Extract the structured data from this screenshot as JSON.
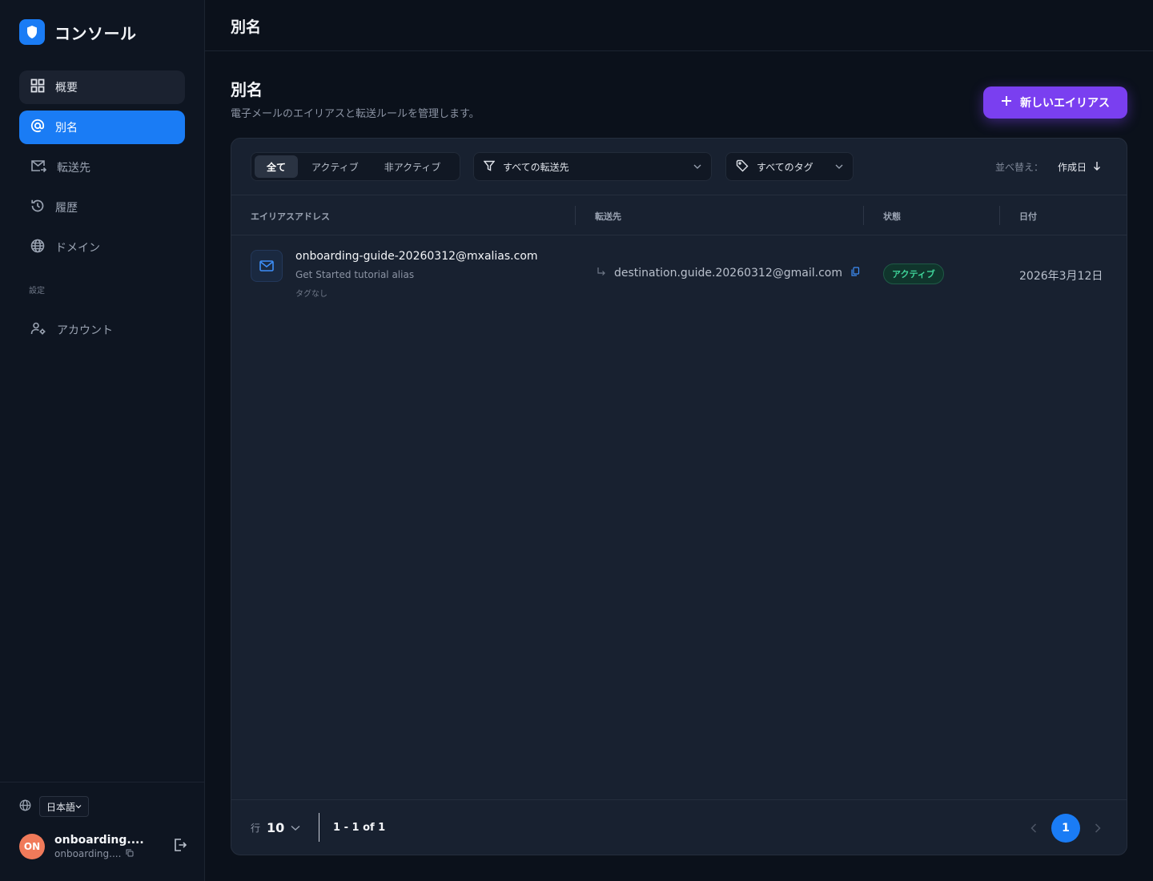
{
  "app": {
    "name": "コンソール"
  },
  "sidebar": {
    "items": [
      {
        "label": "概要",
        "icon": "grid-icon"
      },
      {
        "label": "別名",
        "icon": "at-sign-icon"
      },
      {
        "label": "転送先",
        "icon": "mail-forward-icon"
      },
      {
        "label": "履歴",
        "icon": "history-icon"
      },
      {
        "label": "ドメイン",
        "icon": "globe-icon"
      }
    ],
    "section_label": "設定",
    "settings_items": [
      {
        "label": "アカウント",
        "icon": "user-settings-icon"
      }
    ],
    "language": "日本語",
    "user": {
      "initials": "ON",
      "name": "onboarding....",
      "email": "onboarding...."
    }
  },
  "header": {
    "title": "別名"
  },
  "main": {
    "title": "別名",
    "subtitle": "電子メールのエイリアスと転送ルールを管理します。",
    "new_button": "新しいエイリアス",
    "filters": {
      "tabs": [
        "全て",
        "アクティブ",
        "非アクティブ"
      ],
      "destination": "すべての転送先",
      "tags": "すべてのタグ",
      "sort_label": "並べ替え：",
      "sort_value": "作成日"
    },
    "table": {
      "columns": [
        "エイリアスアドレス",
        "転送先",
        "状態",
        "日付"
      ],
      "rows": [
        {
          "alias": "onboarding-guide-20260312@mxalias.com",
          "description": "Get Started tutorial alias",
          "tags": "タグなし",
          "destination": "destination.guide.20260312@gmail.com",
          "status": "アクティブ",
          "date": "2026年3月12日"
        }
      ]
    },
    "pagination": {
      "rows_label": "行",
      "rows_per_page": "10",
      "range": "1 - 1 of 1",
      "current_page": "1"
    }
  },
  "colors": {
    "accent": "#1a7cf5",
    "primary_button": "#7a3ff0",
    "status_active": "#3fd49a"
  }
}
